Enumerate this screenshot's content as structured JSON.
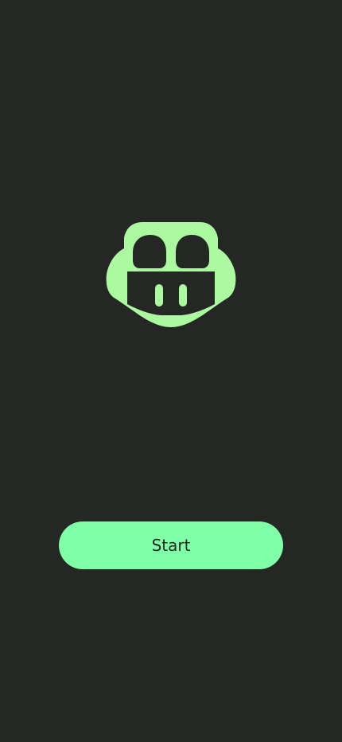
{
  "screen": {
    "background_color": "#252725"
  },
  "logo": {
    "icon": "copilot-face-icon",
    "color": "#abfaa0"
  },
  "start_button": {
    "label": "Start",
    "background_color": "#7fffa8",
    "text_color": "#252725"
  }
}
